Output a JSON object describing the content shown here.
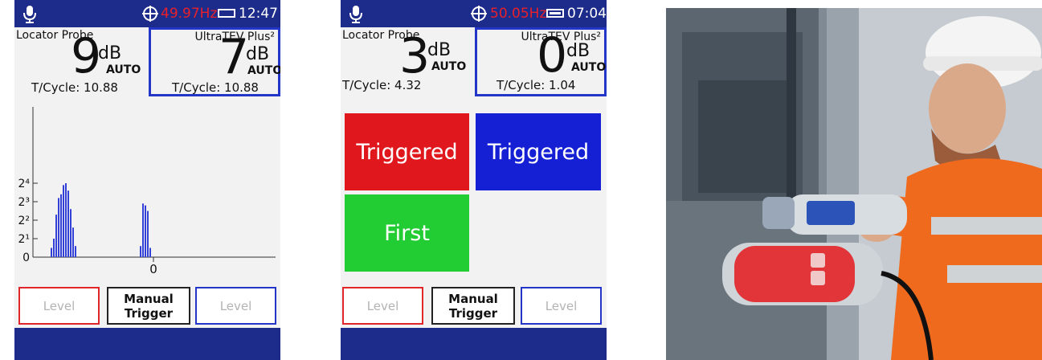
{
  "colors": {
    "bar": "#1d2c8a",
    "red": "#e0262b",
    "blue": "#2436c7",
    "green": "#22cc33",
    "frequency": "#e8202a"
  },
  "screen1": {
    "status": {
      "frequency": "49.97Hz",
      "time": "12:47",
      "battery": "battery-empty-icon"
    },
    "probe": {
      "label": "Locator Probe",
      "value": "9",
      "unit": "dB",
      "mode": "AUTO",
      "cycle": "T/Cycle: 10.88"
    },
    "tev": {
      "label": "UltraTEV Plus²",
      "value": "7",
      "unit": "dB",
      "mode": "AUTO",
      "cycle": "T/Cycle: 10.88"
    },
    "buttons": {
      "level_left": "Level",
      "manual_line1": "Manual",
      "manual_line2": "Trigger",
      "level_right": "Level"
    }
  },
  "screen2": {
    "status": {
      "frequency": "50.05Hz",
      "time": "07:04",
      "battery": "battery-full-icon"
    },
    "probe": {
      "label": "Locator Probe",
      "value": "3",
      "unit": "dB",
      "mode": "AUTO",
      "cycle": "T/Cycle: 4.32"
    },
    "tev": {
      "label": "UltraTEV Plus²",
      "value": "0",
      "unit": "dB",
      "mode": "AUTO",
      "cycle": "T/Cycle: 1.04"
    },
    "tiles": {
      "red": "Triggered",
      "blue": "Triggered",
      "green": "First"
    },
    "buttons": {
      "level_left": "Level",
      "manual_line1": "Manual",
      "manual_line2": "Trigger",
      "level_right": "Level"
    }
  },
  "chart_data": {
    "type": "bar",
    "ytick_labels": [
      "0",
      "2¹",
      "2²",
      "2³",
      "2⁴"
    ],
    "x_center_label": "0",
    "series": [
      {
        "values": [
          0.5,
          1.0,
          2.3,
          3.2,
          3.4,
          3.9,
          4.0,
          3.6,
          2.6,
          1.6,
          0.6
        ]
      },
      {
        "values": [
          0.6,
          2.9,
          2.8,
          2.5,
          0.5
        ]
      }
    ]
  },
  "photo": {
    "subject": "technician using UltraTEV Plus² with Locator probe on switchgear"
  }
}
